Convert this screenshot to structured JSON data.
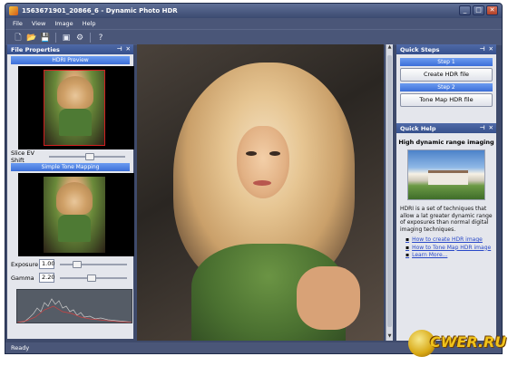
{
  "window": {
    "title": "1563671901_20866_6 - Dynamic Photo HDR",
    "buttons": {
      "minimize": "_",
      "maximize": "□",
      "close": "✕"
    }
  },
  "menu": [
    "File",
    "View",
    "Image",
    "Help"
  ],
  "toolbar": {
    "icons": [
      "new-icon",
      "open-icon",
      "save-icon",
      "image-icon",
      "settings-icon",
      "help-icon"
    ]
  },
  "left_panel": {
    "title": "File Properties",
    "hdri_preview_label": "HDRI Preview",
    "slice_label": "Slice EV Shift",
    "simple_tone_label": "Simple Tone Mapping",
    "exposure_label": "Exposure",
    "exposure_value": "1.00",
    "gamma_label": "Gamma",
    "gamma_value": "2.20"
  },
  "quick_steps": {
    "title": "Quick Steps",
    "step1_label": "Step 1",
    "step1_button": "Create HDR file",
    "step2_label": "Step 2",
    "step2_button": "Tone Map HDR file"
  },
  "quick_help": {
    "title": "Quick Help",
    "heading": "High dynamic range imaging",
    "body": "HDRI is a set of techniques that allow a lat greater dynamic range of exposures than normal digital imaging techniques.",
    "links": [
      "How to create HDR image",
      "How to Tone Map HDR image",
      "Learn More..."
    ]
  },
  "status": {
    "text": "Ready"
  },
  "watermark": {
    "text": "CWER.RU"
  },
  "colors": {
    "frame": "#3e4a6b",
    "panel_header": "#3c5a9c",
    "step_bar": "#4a7ee0",
    "link": "#2848c8"
  }
}
